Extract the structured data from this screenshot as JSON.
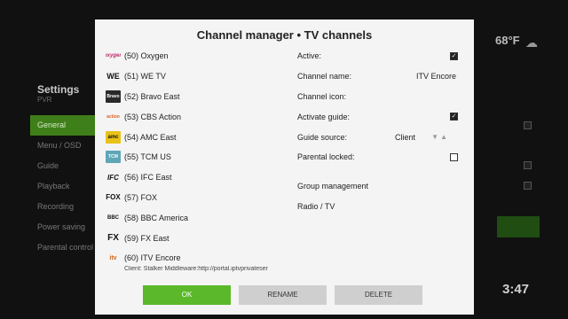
{
  "background": {
    "settings_title": "Settings",
    "settings_sub": "PVR",
    "menu": [
      "General",
      "Menu / OSD",
      "Guide",
      "Playback",
      "Recording",
      "Power saving",
      "Parental control"
    ],
    "temperature": "68°F",
    "clock": "3:47"
  },
  "dialog": {
    "title": "Channel manager • TV channels",
    "channels": [
      {
        "label": "(50) Oxygen",
        "logo": "oxygen"
      },
      {
        "label": "(51) WE TV",
        "logo": "WE"
      },
      {
        "label": "(52) Bravo East",
        "logo": "Bravo"
      },
      {
        "label": "(53) CBS Action",
        "logo": "action"
      },
      {
        "label": "(54) AMC East",
        "logo": "amc"
      },
      {
        "label": "(55) TCM US",
        "logo": "TCM"
      },
      {
        "label": "(56) IFC East",
        "logo": "IFC"
      },
      {
        "label": "(57) FOX",
        "logo": "FOX"
      },
      {
        "label": "(58) BBC America",
        "logo": "BBC"
      },
      {
        "label": "(59) FX East",
        "logo": "FX"
      },
      {
        "label": "(60) ITV Encore",
        "logo": "itv"
      }
    ],
    "client_info": "Client: Stalker Middleware:http://portal.iptvprivateser",
    "properties": {
      "active_label": "Active:",
      "channel_name_label": "Channel name:",
      "channel_name_value": "ITV Encore",
      "channel_icon_label": "Channel icon:",
      "activate_guide_label": "Activate guide:",
      "guide_source_label": "Guide source:",
      "guide_source_value": "Client",
      "parental_locked_label": "Parental locked:",
      "group_management": "Group management",
      "radio_tv": "Radio / TV"
    },
    "buttons": {
      "ok": "OK",
      "rename": "RENAME",
      "delete": "DELETE"
    }
  },
  "colors": {
    "accent": "#5ab82a",
    "dialog_bg": "#f4f4f4",
    "button": "#cfcfcf"
  }
}
